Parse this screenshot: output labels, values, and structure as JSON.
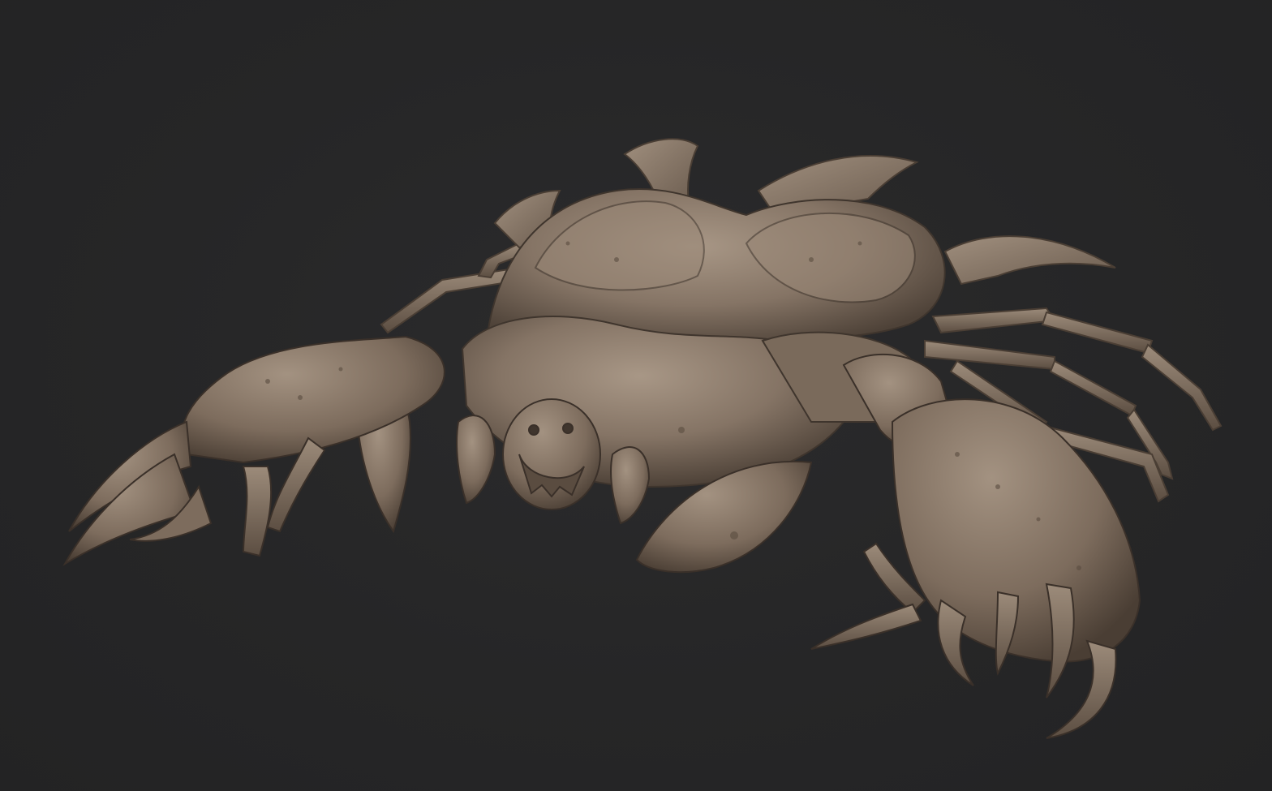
{
  "scene": {
    "background_color": "#262627",
    "material_color": "#8b7a6a",
    "material_shadow_color": "#4a3e34",
    "material_highlight_color": "#a89786",
    "subject": "sculpted-creature"
  }
}
